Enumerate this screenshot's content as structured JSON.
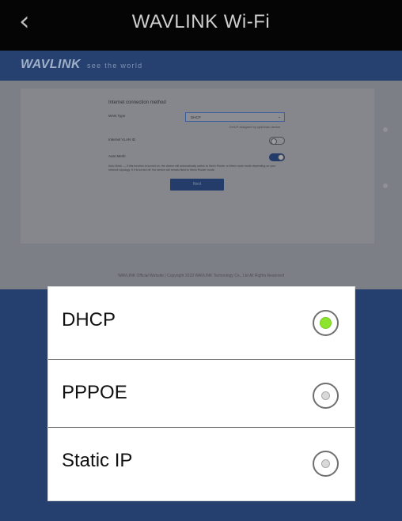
{
  "app": {
    "title": "WAVLINK Wi-Fi"
  },
  "brand": {
    "logo": "WAVLINK",
    "tagline": "see the world"
  },
  "page": {
    "heading": "Internet connection method",
    "wan_type_label": "WAN Type",
    "wan_type_value": "DHCP",
    "wan_type_hint": "DHCP assigned by upstream device",
    "vlan_label": "Internet VLAN ID",
    "vlan_enabled": false,
    "auto_mesh_label": "Auto Mesh",
    "auto_mesh_enabled": true,
    "auto_mesh_desc": "Auto Mesh — If this function is turned on, the device will automatically switch to Mesh Router or Mesh node mode depending on your network topology. If it is turned off, the device will remain fixed in Mesh Router mode.",
    "next_button": "Next",
    "footer": "WAVLINK Official Website | Copyright 2023 WAVLINK Technology Co., Ltd All Rights Reserved"
  },
  "dialog": {
    "options": [
      {
        "label": "DHCP",
        "selected": true
      },
      {
        "label": "PPPOE",
        "selected": false
      },
      {
        "label": "Static IP",
        "selected": false
      }
    ]
  },
  "colors": {
    "accent": "#8be42d",
    "brand_blue": "#25406e",
    "appbar": "#050505"
  },
  "icons": {
    "back": "chevron-left-icon"
  }
}
